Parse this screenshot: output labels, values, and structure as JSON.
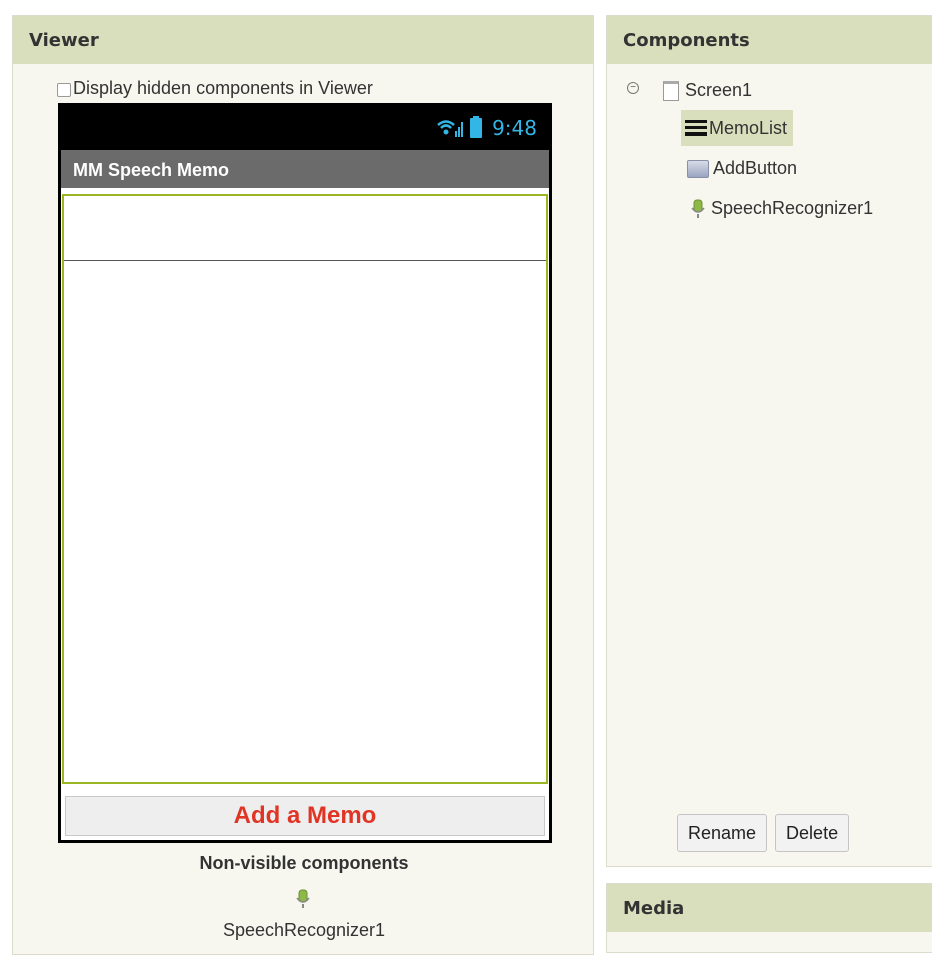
{
  "viewer": {
    "title": "Viewer",
    "hidden_toggle_label": "Display hidden components in Viewer",
    "phone": {
      "clock": "9:48",
      "app_title": "MM Speech Memo",
      "add_button_label": "Add a Memo"
    },
    "nonvisible_title": "Non-visible components",
    "nonvisible_items": [
      "SpeechRecognizer1"
    ]
  },
  "components": {
    "title": "Components",
    "tree": {
      "root": "Screen1",
      "children": [
        "MemoList",
        "AddButton",
        "SpeechRecognizer1"
      ]
    },
    "selected": "MemoList",
    "buttons": {
      "rename": "Rename",
      "delete": "Delete"
    }
  },
  "media": {
    "title": "Media"
  },
  "colors": {
    "header_bg": "#d9dfbd",
    "panel_bg": "#f7f7ef",
    "memo_border": "#9ab623",
    "add_text": "#e03525",
    "status_icons": "#33b5e5"
  }
}
